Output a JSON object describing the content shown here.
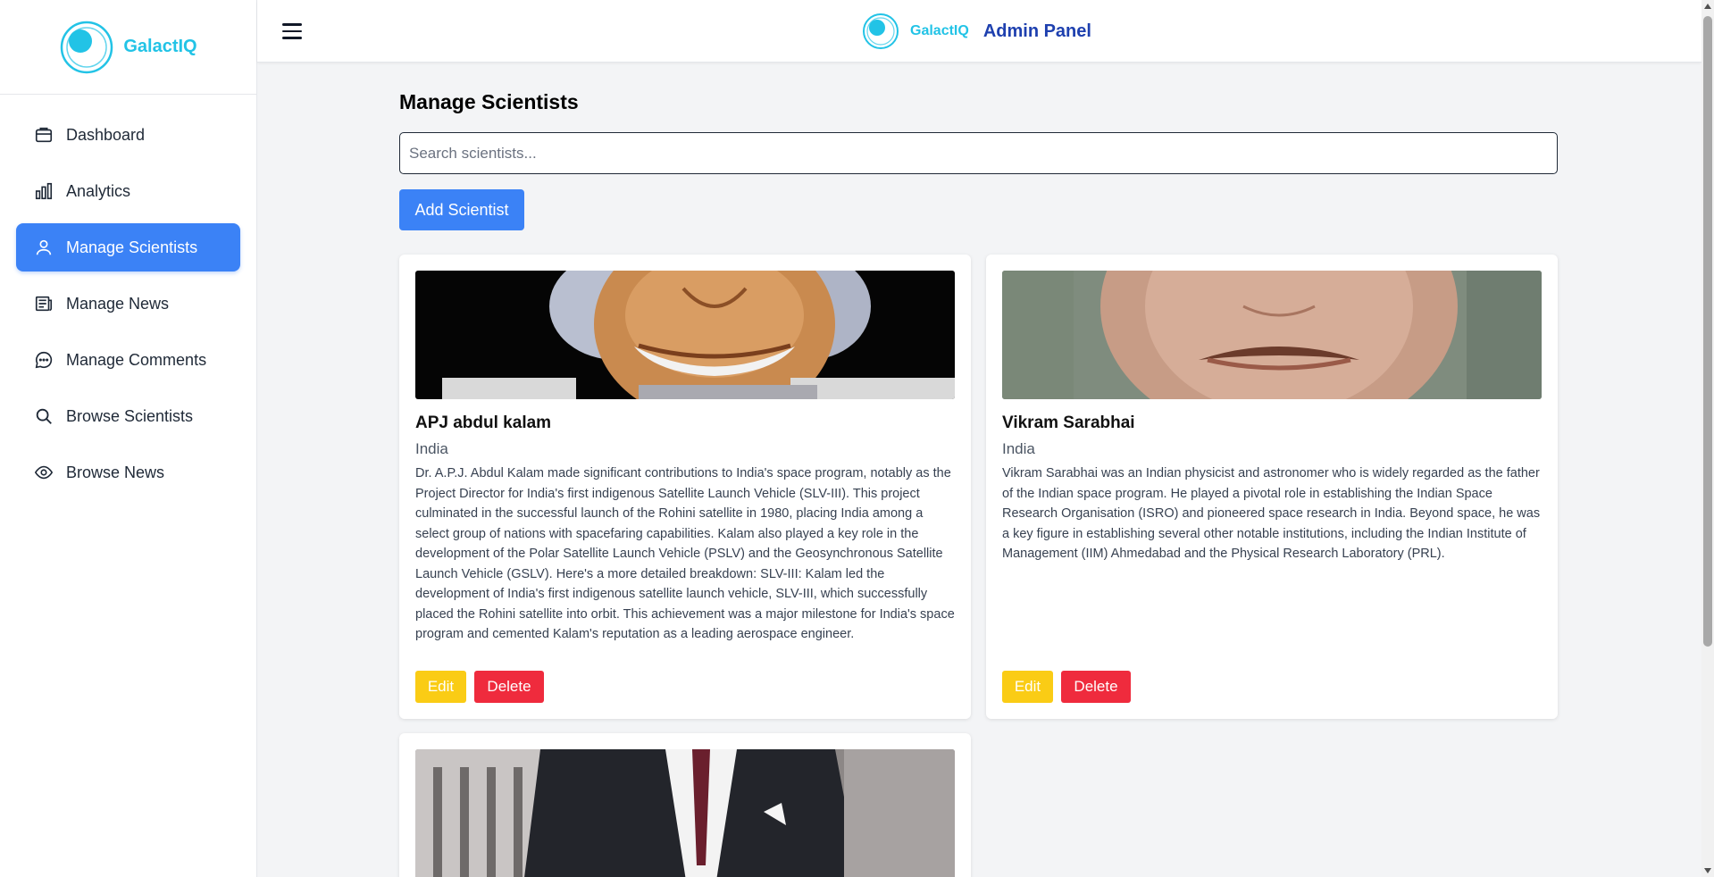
{
  "sidebar": {
    "brand": "GalactIQ",
    "items": [
      {
        "label": "Dashboard",
        "icon": "dashboard-icon"
      },
      {
        "label": "Analytics",
        "icon": "bar-chart-icon"
      },
      {
        "label": "Manage Scientists",
        "icon": "user-icon",
        "active": true
      },
      {
        "label": "Manage News",
        "icon": "newspaper-icon"
      },
      {
        "label": "Manage Comments",
        "icon": "comment-icon"
      },
      {
        "label": "Browse Scientists",
        "icon": "search-icon"
      },
      {
        "label": "Browse News",
        "icon": "eye-icon"
      }
    ]
  },
  "header": {
    "brand": "GalactIQ",
    "title": "Admin Panel"
  },
  "main": {
    "title": "Manage Scientists",
    "search_placeholder": "Search scientists...",
    "add_button": "Add Scientist",
    "cards": [
      {
        "name": "APJ abdul kalam",
        "country": "India",
        "description": "Dr. A.P.J. Abdul Kalam made significant contributions to India's space program, notably as the Project Director for India's first indigenous Satellite Launch Vehicle (SLV-III). This project culminated in the successful launch of the Rohini satellite in 1980, placing India among a select group of nations with spacefaring capabilities. Kalam also played a key role in the development of the Polar Satellite Launch Vehicle (PSLV) and the Geosynchronous Satellite Launch Vehicle (GSLV). Here's a more detailed breakdown: SLV-III: Kalam led the development of India's first indigenous satellite launch vehicle, SLV-III, which successfully placed the Rohini satellite into orbit. This achievement was a major milestone for India's space program and cemented Kalam's reputation as a leading aerospace engineer.",
        "edit": "Edit",
        "delete": "Delete"
      },
      {
        "name": "Vikram Sarabhai",
        "country": "India",
        "description": "Vikram Sarabhai was an Indian physicist and astronomer who is widely regarded as the father of the Indian space program. He played a pivotal role in establishing the Indian Space Research Organisation (ISRO) and pioneered space research in India. Beyond space, he was a key figure in establishing several other notable institutions, including the Indian Institute of Management (IIM) Ahmedabad and the Physical Research Laboratory (PRL).",
        "edit": "Edit",
        "delete": "Delete"
      }
    ]
  },
  "colors": {
    "accent": "#3b82f6",
    "brand": "#22c3e6",
    "edit": "#facc15",
    "delete": "#ef2b3d"
  }
}
